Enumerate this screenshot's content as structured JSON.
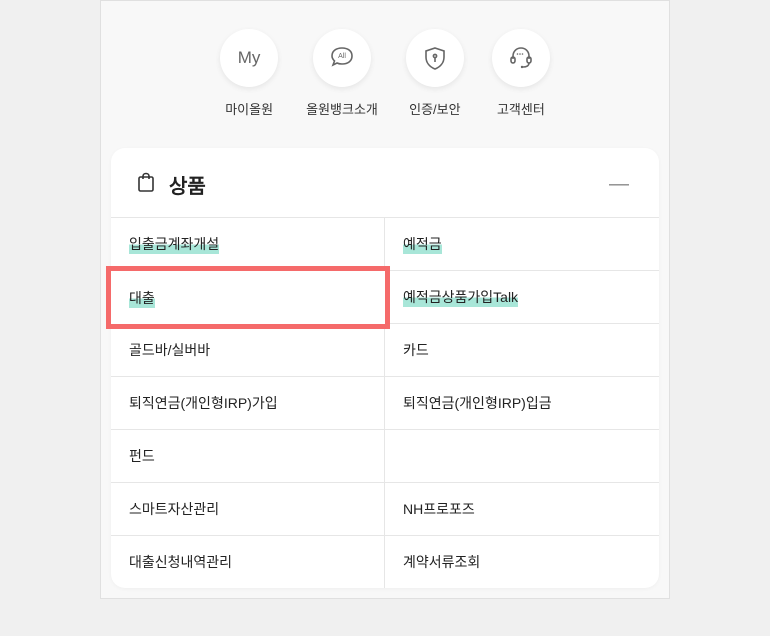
{
  "quickMenu": [
    {
      "label": "마이올원",
      "icon": "My"
    },
    {
      "label": "올원뱅크소개",
      "icon": "All"
    },
    {
      "label": "인증/보안",
      "icon": "shield"
    },
    {
      "label": "고객센터",
      "icon": "headset"
    }
  ],
  "card": {
    "title": "상품",
    "collapse": "—"
  },
  "grid": [
    {
      "label": "입출금계좌개설",
      "highlight": true,
      "emphasis": false
    },
    {
      "label": "예적금",
      "highlight": true,
      "emphasis": false
    },
    {
      "label": "대출",
      "highlight": true,
      "emphasis": true
    },
    {
      "label": "예적금상품가입Talk",
      "highlight": true,
      "emphasis": false
    },
    {
      "label": "골드바/실버바",
      "highlight": false,
      "emphasis": false
    },
    {
      "label": "카드",
      "highlight": false,
      "emphasis": false
    },
    {
      "label": "퇴직연금(개인형IRP)가입",
      "highlight": false,
      "emphasis": false
    },
    {
      "label": "퇴직연금(개인형IRP)입금",
      "highlight": false,
      "emphasis": false
    },
    {
      "label": "펀드",
      "highlight": false,
      "emphasis": false
    },
    {
      "label": "",
      "highlight": false,
      "emphasis": false
    },
    {
      "label": "스마트자산관리",
      "highlight": false,
      "emphasis": false
    },
    {
      "label": "NH프로포즈",
      "highlight": false,
      "emphasis": false
    },
    {
      "label": "대출신청내역관리",
      "highlight": false,
      "emphasis": false
    },
    {
      "label": "계약서류조회",
      "highlight": false,
      "emphasis": false
    }
  ]
}
